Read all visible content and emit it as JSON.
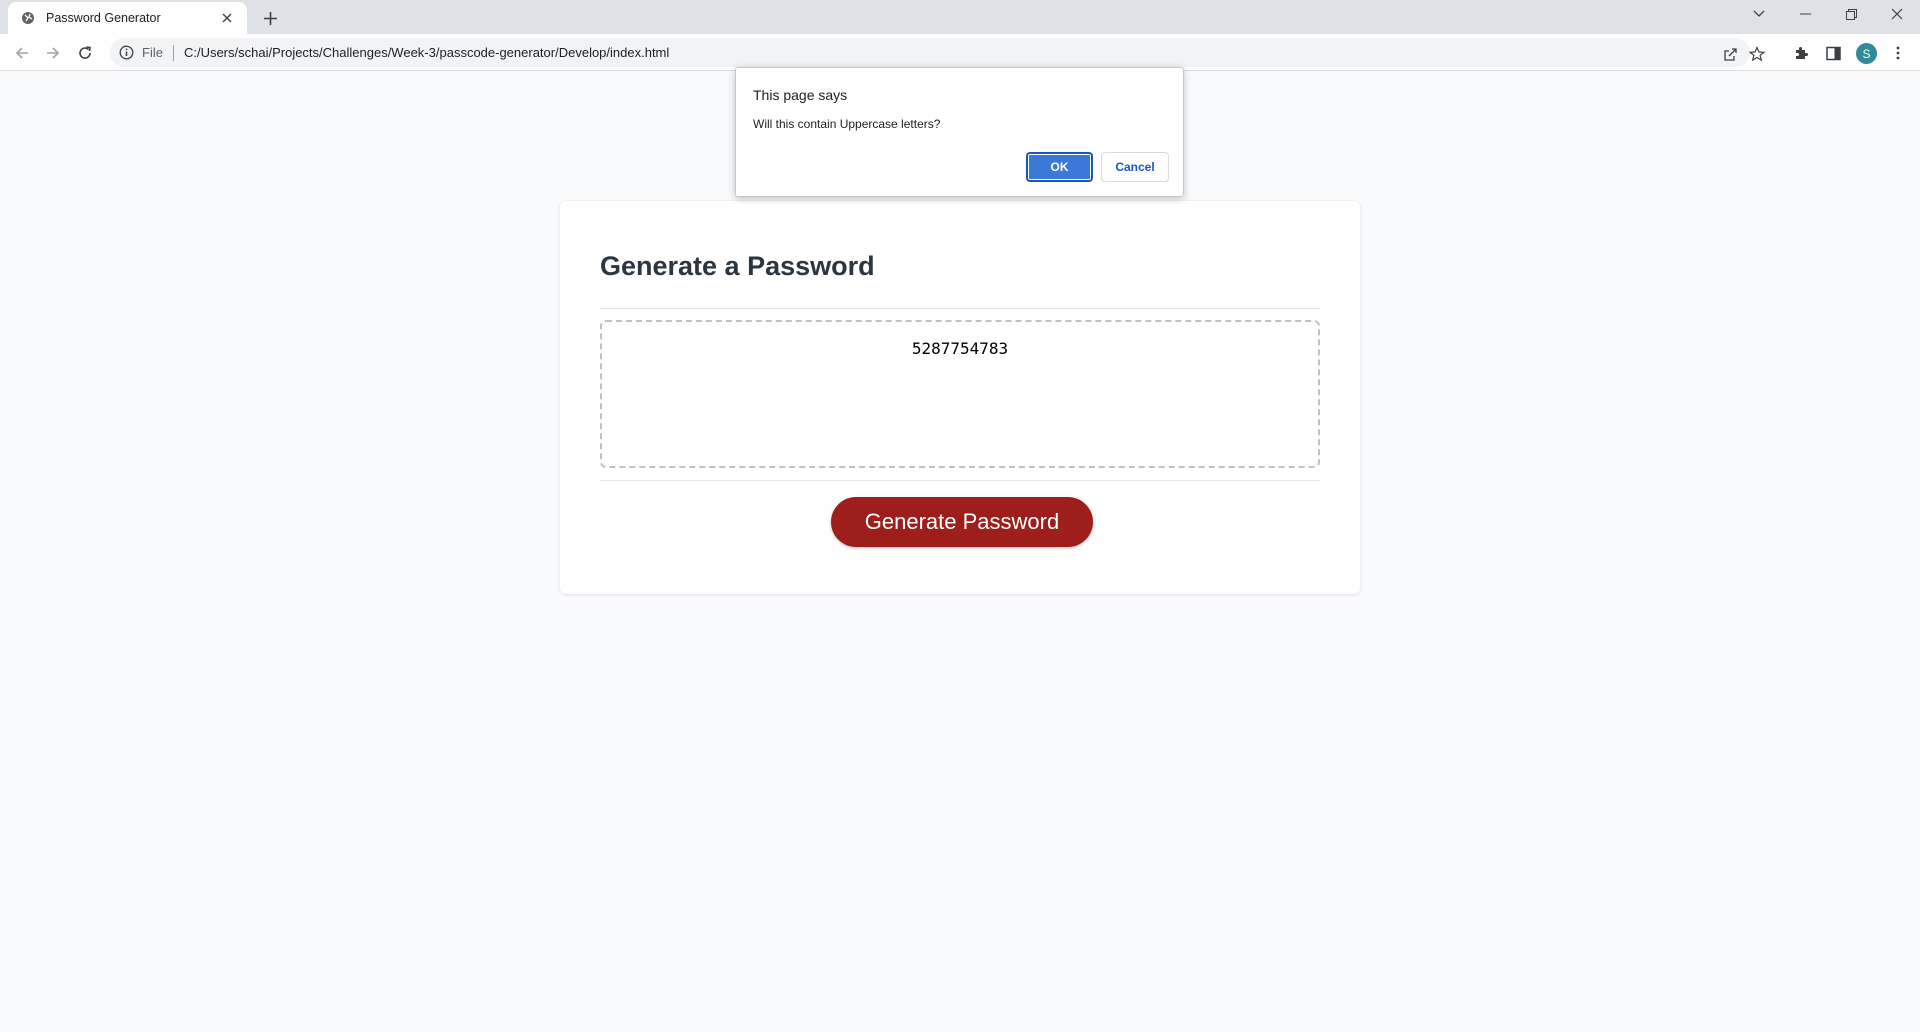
{
  "browser": {
    "tab": {
      "title": "Password Generator",
      "favicon": "globe-icon"
    },
    "address_bar": {
      "scheme_label": "File",
      "url": "C:/Users/schai/Projects/Challenges/Week-3/passcode-generator/Develop/index.html"
    },
    "profile_initial": "S"
  },
  "page": {
    "title": "Generate a Password",
    "password_value": "5287754783",
    "generate_button_label": "Generate Password"
  },
  "dialog": {
    "title": "This page says",
    "message": "Will this contain Uppercase letters?",
    "ok_label": "OK",
    "cancel_label": "Cancel"
  },
  "colors": {
    "accent_button": "#9d1e1b",
    "dialog_primary": "#3c78d8",
    "page_background": "#f9fafc"
  }
}
